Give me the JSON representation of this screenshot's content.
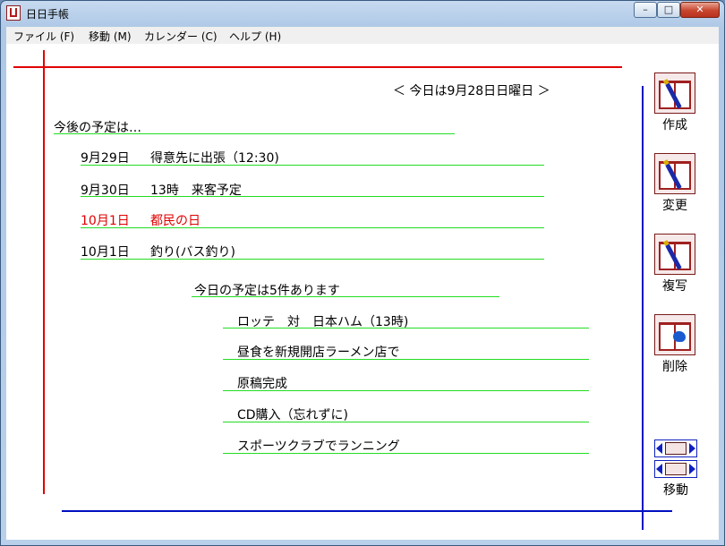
{
  "window": {
    "title": "日日手帳",
    "minimize": "–",
    "maximize": "□",
    "close": "✕"
  },
  "menu": [
    {
      "label": "ファイル (F)"
    },
    {
      "label": "移動 (M)"
    },
    {
      "label": "カレンダー (C)"
    },
    {
      "label": "ヘルプ (H)"
    }
  ],
  "date_nav": "＜ 今日は9月28日日曜日 ＞",
  "upcoming": {
    "heading": "今後の予定は…",
    "items": [
      {
        "date": "9月29日",
        "title": "得意先に出張（12:30)",
        "color": "#000000"
      },
      {
        "date": "9月30日",
        "title": "13時　来客予定",
        "color": "#000000"
      },
      {
        "date": "10月1日",
        "title": "都民の日",
        "color": "#e00000"
      },
      {
        "date": "10月1日",
        "title": "釣り(バス釣り)",
        "color": "#000000"
      }
    ]
  },
  "today": {
    "heading": "今日の予定は5件あります",
    "items": [
      {
        "title": "ロッテ　対　日本ハム（13時)"
      },
      {
        "title": "昼食を新規開店ラーメン店で"
      },
      {
        "title": "原稿完成"
      },
      {
        "title": "CD購入（忘れずに)"
      },
      {
        "title": "スポーツクラブでランニング"
      }
    ]
  },
  "tools": {
    "create": {
      "label": "作成",
      "icon": "book-pen-icon"
    },
    "edit": {
      "label": "変更",
      "icon": "book-pen-icon"
    },
    "copy": {
      "label": "複写",
      "icon": "book-copy-icon"
    },
    "delete": {
      "label": "削除",
      "icon": "book-eraser-icon"
    },
    "move": {
      "label": "移動",
      "icon": "book-arrows-icon"
    }
  },
  "colors": {
    "margin_red": "#e00000",
    "margin_blue": "#0010c0",
    "underline_green": "#22dd22"
  }
}
